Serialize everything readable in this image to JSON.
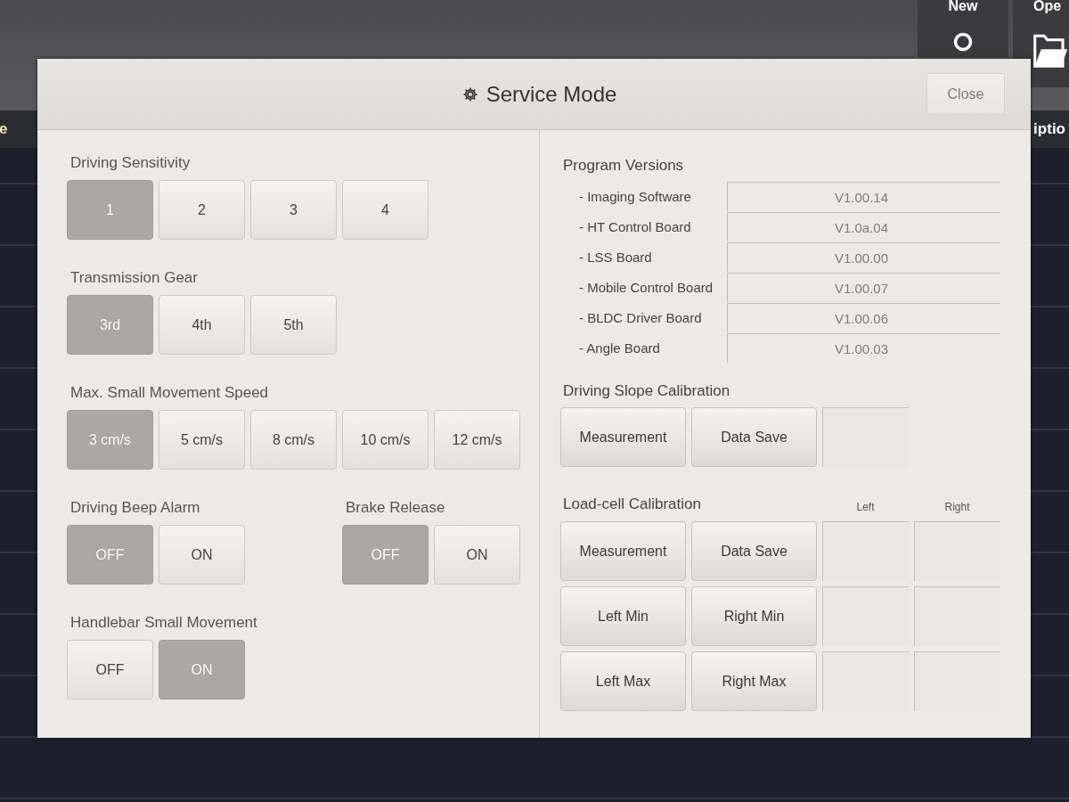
{
  "background": {
    "toolbar": [
      {
        "label": "New"
      },
      {
        "label": "Ope"
      }
    ],
    "left_text": "e",
    "right_text": "iptio"
  },
  "dialog": {
    "title": "Service Mode",
    "close_button": "Close",
    "left_panel": {
      "rows": [
        {
          "settings": [
            {
              "label": "Driving Sensitivity",
              "options": [
                {
                  "label": "1",
                  "selected": true
                },
                {
                  "label": "2",
                  "selected": false
                },
                {
                  "label": "3",
                  "selected": false
                },
                {
                  "label": "4",
                  "selected": false
                }
              ]
            }
          ]
        },
        {
          "settings": [
            {
              "label": "Transmission Gear",
              "options": [
                {
                  "label": "3rd",
                  "selected": true
                },
                {
                  "label": "4th",
                  "selected": false
                },
                {
                  "label": "5th",
                  "selected": false
                }
              ]
            }
          ]
        },
        {
          "settings": [
            {
              "label": "Max. Small Movement Speed",
              "options": [
                {
                  "label": "3 cm/s",
                  "selected": true
                },
                {
                  "label": "5 cm/s",
                  "selected": false
                },
                {
                  "label": "8 cm/s",
                  "selected": false
                },
                {
                  "label": "10 cm/s",
                  "selected": false
                },
                {
                  "label": "12 cm/s",
                  "selected": false
                }
              ]
            }
          ]
        },
        {
          "settings": [
            {
              "label": "Driving Beep Alarm",
              "options": [
                {
                  "label": "OFF",
                  "selected": true
                },
                {
                  "label": "ON",
                  "selected": false
                }
              ]
            },
            {
              "label": "Brake Release",
              "options": [
                {
                  "label": "OFF",
                  "selected": true
                },
                {
                  "label": "ON",
                  "selected": false
                }
              ]
            }
          ]
        },
        {
          "settings": [
            {
              "label": "Handlebar Small Movement",
              "options": [
                {
                  "label": "OFF",
                  "selected": false
                },
                {
                  "label": "ON",
                  "selected": true
                }
              ]
            }
          ]
        }
      ]
    },
    "right_panel": {
      "program_versions": {
        "heading": "Program Versions",
        "items": [
          {
            "label": "- Imaging Software",
            "value": "V1.00.14"
          },
          {
            "label": "- HT Control Board",
            "value": "V1.0a.04"
          },
          {
            "label": "- LSS Board",
            "value": "V1.00.00"
          },
          {
            "label": "- Mobile Control Board",
            "value": "V1.00.07"
          },
          {
            "label": "- BLDC Driver Board",
            "value": "V1.00.06"
          },
          {
            "label": "- Angle Board",
            "value": "V1.00.03"
          }
        ]
      },
      "driving_slope_calibration": {
        "heading": "Driving Slope Calibration",
        "buttons": [
          "Measurement",
          "Data Save"
        ]
      },
      "load_cell_calibration": {
        "heading": "Load-cell Calibration",
        "column_headers": [
          "Left",
          "Right"
        ],
        "rows": [
          {
            "buttons": [
              "Measurement",
              "Data Save"
            ]
          },
          {
            "buttons": [
              "Left Min",
              "Right Min"
            ]
          },
          {
            "buttons": [
              "Left Max",
              "Right Max"
            ]
          }
        ]
      }
    }
  }
}
